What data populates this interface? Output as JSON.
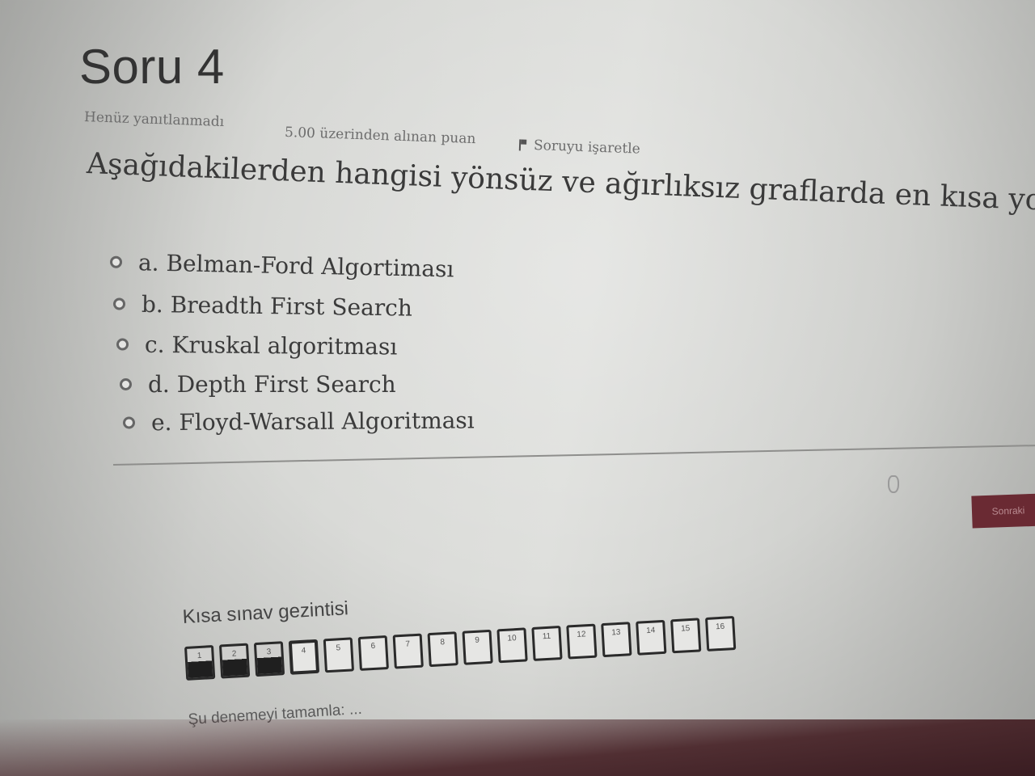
{
  "question": {
    "title": "Soru 4",
    "status": "Henüz yanıtlanmadı",
    "grade": "5.00 üzerinden alınan puan",
    "flag_label": "Soruyu işaretle",
    "text": "Aşağıdakilerden hangisi yönsüz ve ağırlıksız graflarda en kısa yolu bulur?"
  },
  "answers": [
    {
      "label": "a. Belman-Ford Algortiması"
    },
    {
      "label": "b. Breadth First Search"
    },
    {
      "label": "c. Kruskal algoritması"
    },
    {
      "label": "d. Depth First Search"
    },
    {
      "label": "e. Floyd-Warsall Algoritması"
    }
  ],
  "next_button": {
    "label": "Sonraki"
  },
  "quiz_nav": {
    "title": "Kısa sınav gezintisi",
    "pages": [
      {
        "n": "1",
        "state": "answered"
      },
      {
        "n": "2",
        "state": "answered"
      },
      {
        "n": "3",
        "state": "answered"
      },
      {
        "n": "4",
        "state": "current"
      },
      {
        "n": "5",
        "state": "unanswered"
      },
      {
        "n": "6",
        "state": "unanswered"
      },
      {
        "n": "7",
        "state": "unanswered"
      },
      {
        "n": "8",
        "state": "unanswered"
      },
      {
        "n": "9",
        "state": "unanswered"
      },
      {
        "n": "10",
        "state": "unanswered"
      },
      {
        "n": "11",
        "state": "unanswered"
      },
      {
        "n": "12",
        "state": "unanswered"
      },
      {
        "n": "13",
        "state": "unanswered"
      },
      {
        "n": "14",
        "state": "unanswered"
      },
      {
        "n": "15",
        "state": "unanswered"
      },
      {
        "n": "16",
        "state": "unanswered"
      }
    ],
    "finish_link": "Şu denemeyi tamamla: ..."
  },
  "colors": {
    "accent": "#6a2a33",
    "background": "#dcdcd9"
  }
}
